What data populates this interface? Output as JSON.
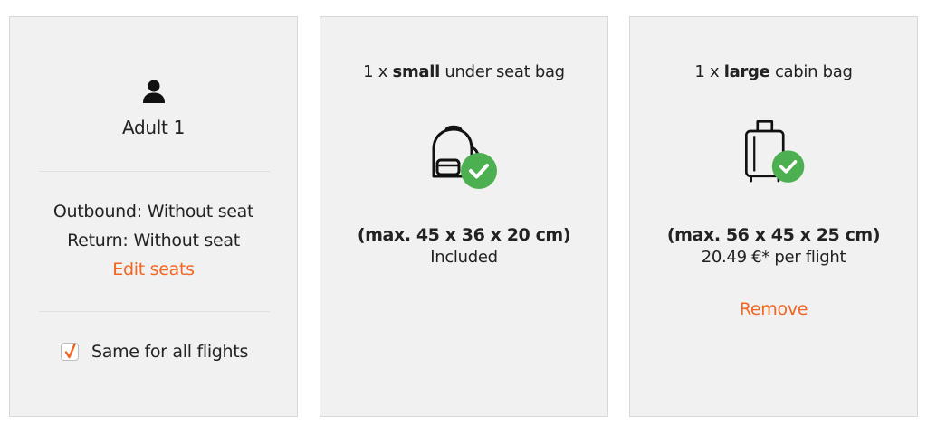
{
  "passenger": {
    "name": "Adult 1",
    "outbound_label": "Outbound:",
    "outbound_value": "Without seat",
    "return_label": "Return:",
    "return_value": "Without seat",
    "edit_seats": "Edit seats",
    "same_for_all": "Same for all flights",
    "same_for_all_checked": true,
    "icon": "person-icon"
  },
  "small_bag": {
    "title_prefix": "1 x ",
    "title_bold": "small",
    "title_suffix": " under seat bag",
    "dimensions": "(max. 45 x 36 x 20 cm)",
    "price": "Included",
    "icon": "backpack-icon"
  },
  "large_bag": {
    "title_prefix": "1 x ",
    "title_bold": "large",
    "title_suffix": " cabin bag",
    "dimensions": "(max. 56 x 45 x 25 cm)",
    "price": "20.49 €* per flight",
    "remove": "Remove",
    "icon": "suitcase-icon"
  },
  "colors": {
    "accent": "#f26522",
    "check_green": "#4caf50",
    "card_bg": "#f1f1f1"
  }
}
